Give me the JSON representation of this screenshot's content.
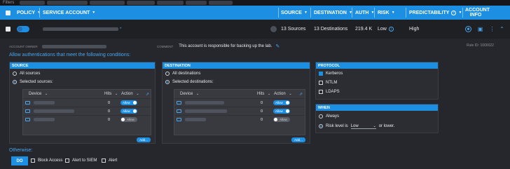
{
  "filters": {
    "label": "Filters"
  },
  "header": {
    "policy": "POLICY",
    "service_account": "SERVICE ACCOUNT",
    "source": "SOURCE",
    "destination": "DESTINATION",
    "auth": "AUTH",
    "risk": "RISK",
    "predictability": "PREDICTABILITY",
    "account_info": "ACCOUNT INFO"
  },
  "row": {
    "sources": "13 Sources",
    "destinations": "13 Destinations",
    "auth": "219.4 K",
    "risk": "Low",
    "predictability": "High"
  },
  "detail": {
    "account_owner_label": "ACCOUNT OWNER",
    "comment_label": "COMMENT",
    "comment": "This account is responsible for backing up the lab.",
    "rule_id": "Rule ID: 1000022",
    "allow_text": "Allow authentications that meet the following conditions:",
    "otherwise": "Otherwise:"
  },
  "source_panel": {
    "title": "SOURCE",
    "all": "All sources",
    "selected": "Selected sources:",
    "col_device": "Device",
    "col_hits": "Hits",
    "col_action": "Action",
    "rows": [
      {
        "hits": "0",
        "action": "Allow",
        "on": true
      },
      {
        "hits": "0",
        "action": "Allow",
        "on": true
      },
      {
        "hits": "0",
        "action": "Allow",
        "on": false
      }
    ],
    "add": "Add..."
  },
  "destination_panel": {
    "title": "DESTINATION",
    "all": "All destinations",
    "selected": "Selected destinations:",
    "col_device": "Device",
    "col_hits": "Hits",
    "col_action": "Action",
    "rows": [
      {
        "hits": "0",
        "action": "Allow",
        "on": true
      },
      {
        "hits": "0",
        "action": "Allow",
        "on": true
      },
      {
        "hits": "0",
        "action": "Allow",
        "on": false
      }
    ],
    "add": "Add..."
  },
  "protocol_panel": {
    "title": "PROTOCOL",
    "options": [
      {
        "label": "Kerberos",
        "checked": true
      },
      {
        "label": "NTLM",
        "checked": false
      },
      {
        "label": "LDAPS",
        "checked": false
      }
    ]
  },
  "when_panel": {
    "title": "WHEN",
    "always": "Always",
    "risk_prefix": "Risk level is",
    "risk_value": "Low",
    "risk_suffix": "or lower."
  },
  "otherwise_actions": {
    "do": "DO",
    "block": "Block Access",
    "alert_siem": "Alert to SIEM",
    "alert": "Alert"
  },
  "colors": {
    "accent": "#1d8fe3",
    "background": "#1b1c20",
    "panel": "#2b2d33"
  }
}
